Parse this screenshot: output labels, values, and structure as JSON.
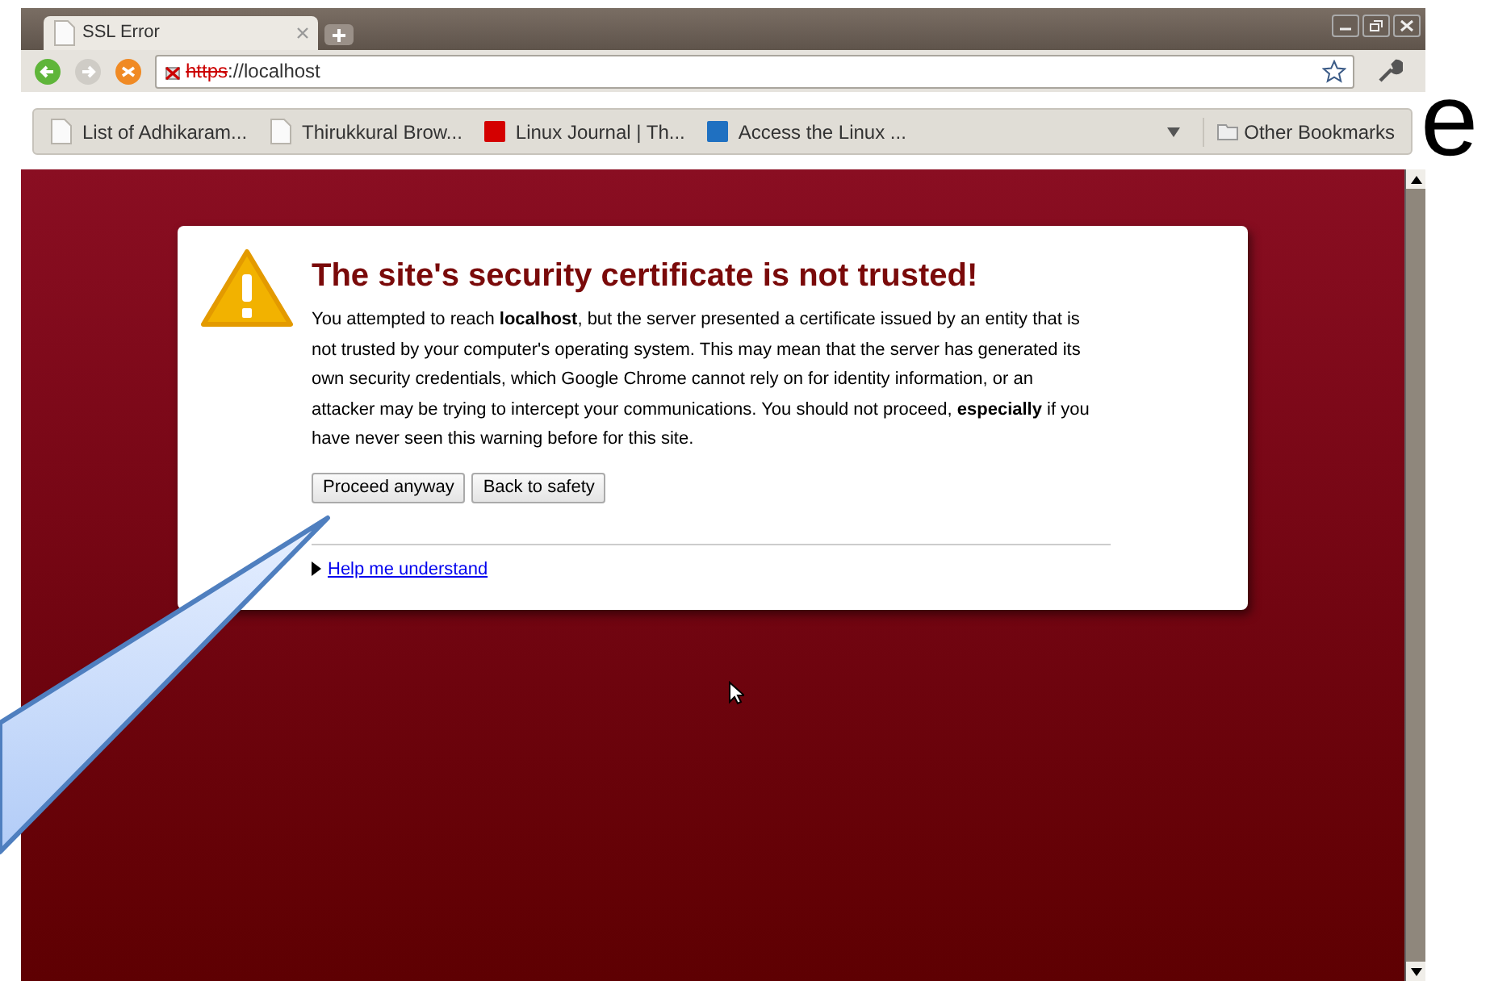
{
  "slide": {
    "letters": [
      "e"
    ]
  },
  "window": {
    "tab": {
      "title": "SSL Error",
      "selected": true
    }
  },
  "toolbar": {
    "address": {
      "scheme": "https",
      "rest": "://localhost",
      "insecure": true
    }
  },
  "bookmarks": {
    "items": [
      {
        "label": "List of Adhikaram...",
        "kind": "page"
      },
      {
        "label": "Thirukkural Brow...",
        "kind": "page"
      },
      {
        "label": "Linux Journal | Th...",
        "kind": "favicon",
        "color": "#d40000"
      },
      {
        "label": "Access the Linux ...",
        "kind": "favicon",
        "color": "#1f70c1"
      }
    ],
    "other": "Other Bookmarks"
  },
  "error": {
    "title": "The site's security certificate is not trusted!",
    "body": "You attempted to reach **localhost**, but the server presented a certificate issued by an entity that is not trusted by your computer's operating system. This may mean that the server has generated its own security credentials, which Google Chrome cannot rely on for identity information, or an attacker may be trying to intercept your communications. You should not proceed, **especially** if you have never seen this warning before for this site.",
    "buttons": [
      "Proceed anyway",
      "Back to safety"
    ],
    "help_link": "Help me understand",
    "help_expanded": false
  }
}
